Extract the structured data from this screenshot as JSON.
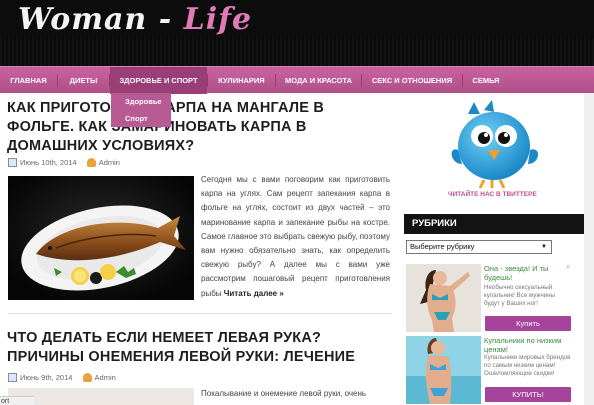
{
  "logo": {
    "part1": "Woman - ",
    "part2": "Life"
  },
  "nav": {
    "items": [
      "ГЛАВНАЯ",
      "ДИЕТЫ",
      "ЗДОРОВЬЕ И СПОРТ",
      "КУЛИНАРИЯ",
      "МОДА И КРАСОТА",
      "СЕКС И ОТНОШЕНИЯ",
      "СЕМЬЯ"
    ],
    "dropdown": [
      "Здоровье",
      "Спорт"
    ]
  },
  "posts": [
    {
      "title": "КАК ПРИГОТОВИТЬ КАРПА НА МАНГАЛЕ В ФОЛЬГЕ. КАК ЗАМАРИНОВАТЬ КАРПА В ДОМАШНИХ УСЛОВИЯХ?",
      "date": "Июнь 10th, 2014",
      "author": "Admin",
      "excerpt": "Сегодня мы с вами поговорим как приготовить карпа на углях. Сам рецепт запекания карпа в фольге на углях, состоит из двух частей – это маринование карпа и запекание рыбы на костре. Самое главное это выбрать свежую рыбу, поэтому вам нужно обязательно знать, как определить свежую рыбу? А далее мы с вами уже рассмотрим пошаговый рецепт приготовления рыбы",
      "more": "Читать далее »"
    },
    {
      "title": "ЧТО ДЕЛАТЬ ЕСЛИ НЕМЕЕТ ЛЕВАЯ РУКА? ПРИЧИНЫ ОНЕМЕНИЯ ЛЕВОЙ РУКИ: ЛЕЧЕНИЕ",
      "date": "Июнь 9th, 2014",
      "author": "Admin",
      "excerpt": "Покалывание и онемение левой руки, очень"
    }
  ],
  "sidebar": {
    "twitter_caption": "ЧИТАЙТЕ НАС В ТВИТТЕРЕ",
    "rubrics_title": "РУБРИКИ",
    "rubrics_select": "Выберите рубрику",
    "ads": [
      {
        "title": "Она - звезда! И ты будешь!",
        "text": "Необычно сексуальный купальник! Все мужчины будут у Ваших ног!",
        "button": "Купить"
      },
      {
        "title": "Купальники по низким ценам!",
        "text": "Купальники мировых брендов по самым низким ценам! Ошеломляющие скидки!",
        "button": "КУПИТЬ!"
      }
    ]
  },
  "status_text": "ort",
  "colors": {
    "accent": "#c24d8e",
    "nav": "#bf5a95",
    "button": "#a6449c"
  }
}
